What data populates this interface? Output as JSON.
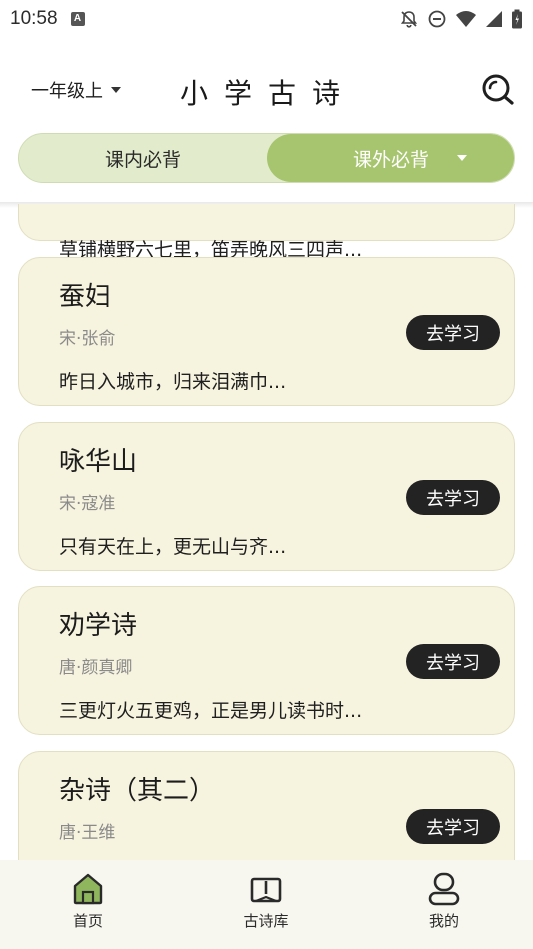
{
  "status": {
    "time": "10:58",
    "badge": "A",
    "icons": [
      "notifications-off-icon",
      "do-not-disturb-icon",
      "wifi-icon",
      "cell-signal-icon",
      "battery-icon"
    ]
  },
  "header": {
    "grade": "一年级上",
    "title": "小学古诗",
    "search_icon": "search-icon"
  },
  "segment": {
    "left": "课内必背",
    "right": "课外必背",
    "active": "right"
  },
  "colors": {
    "accent": "#a6c56e",
    "segment_bg": "#e2eccc",
    "card_bg": "#f6f3df",
    "button_bg": "#232323"
  },
  "poems": [
    {
      "title": "",
      "author": "",
      "line": "草铺横野六七里，笛弄晚风三四声...",
      "button": ""
    },
    {
      "title": "蚕妇",
      "author": "宋·张俞",
      "line": "昨日入城市，归来泪满巾...",
      "button": "去学习"
    },
    {
      "title": "咏华山",
      "author": "宋·寇准",
      "line": "只有天在上，更无山与齐...",
      "button": "去学习"
    },
    {
      "title": "劝学诗",
      "author": "唐·颜真卿",
      "line": "三更灯火五更鸡，正是男儿读书时...",
      "button": "去学习"
    },
    {
      "title": "杂诗（其二）",
      "author": "唐·王维",
      "line": "",
      "button": "去学习"
    }
  ],
  "tabbar": [
    {
      "label": "首页",
      "icon": "home-icon",
      "active": true
    },
    {
      "label": "古诗库",
      "icon": "book-icon",
      "active": false
    },
    {
      "label": "我的",
      "icon": "profile-icon",
      "active": false
    }
  ]
}
